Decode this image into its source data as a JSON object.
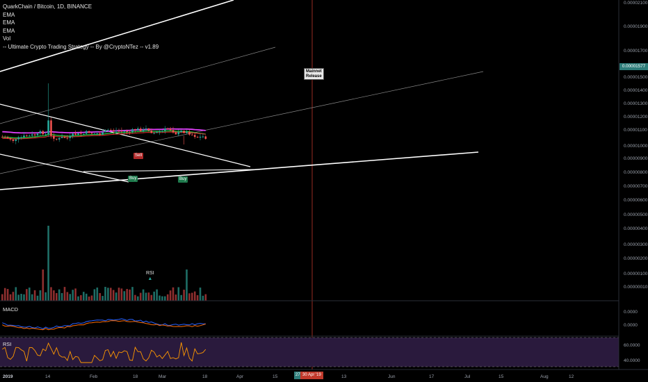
{
  "legend": {
    "symbol": "QuarkChain / Bitcoin, 1D, BINANCE",
    "ema1": "EMA",
    "ema2": "EMA",
    "ema3": "EMA",
    "vol": "Vol",
    "strategy": "-- Ultimate Crypto Trading Strategy -- By @CryptoNTez -- v1.89"
  },
  "annotation": {
    "line1": "Mainnet",
    "line2": "Release"
  },
  "price_axis": {
    "labels": [
      "0.00002100",
      "0.00001900",
      "0.00001700",
      "0.00001500",
      "0.00001400",
      "0.00001300",
      "0.00001200",
      "0.00001100",
      "0.00001000",
      "0.00000900",
      "0.00000800",
      "0.00000700",
      "0.00000600",
      "0.00000500",
      "0.00000400",
      "0.00000300",
      "0.00000200",
      "0.00000100",
      "0.00000010"
    ],
    "current_price": "0.00001577"
  },
  "macd_axis": {
    "labels": [
      "0.0000",
      "0.0000"
    ]
  },
  "rsi_axis": {
    "labels": [
      "60.0000",
      "40.0000"
    ]
  },
  "panes": {
    "macd_title": "MACD",
    "rsi_title": "RSI"
  },
  "signals": {
    "sell": "Sell",
    "buy1": "Buy",
    "buy2": "Buy",
    "rsi_marker": "RSI"
  },
  "time_axis": {
    "labels": [
      "2019",
      "14",
      "Feb",
      "18",
      "Mar",
      "18",
      "Apr",
      "15",
      "13",
      "Jun",
      "17",
      "Jul",
      "15",
      "Aug",
      "12"
    ],
    "badge_left": "27",
    "badge_date": "30 Apr '19"
  },
  "colors": {
    "background": "#000000",
    "up": "#26a69a",
    "down": "#ef5350",
    "ema_green": "#1fbf3a",
    "ema_magenta": "#e040fb",
    "ema_red": "#c62828",
    "trendline": "#ffffff",
    "vertical_marker": "#c0392b",
    "macd_line": "#2962ff",
    "signal_line": "#ff6d00",
    "rsi_line": "#ff9800",
    "rsi_band": "#2a1a3d"
  }
}
